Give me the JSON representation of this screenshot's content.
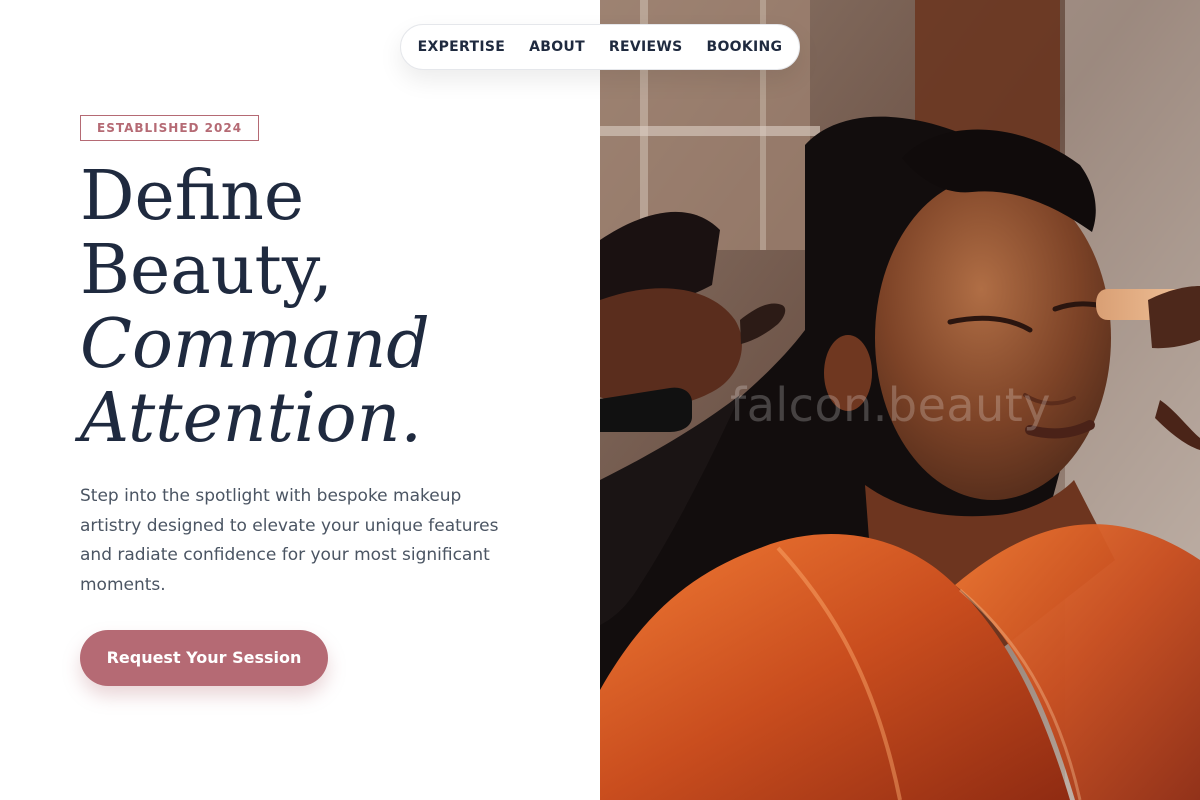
{
  "nav": {
    "items": [
      {
        "label": "EXPERTISE"
      },
      {
        "label": "ABOUT"
      },
      {
        "label": "REVIEWS"
      },
      {
        "label": "BOOKING"
      }
    ]
  },
  "hero": {
    "badge": "ESTABLISHED 2024",
    "headline_line1": "Define",
    "headline_line2": "Beauty,",
    "headline_line3": "Command",
    "headline_line4": "Attention.",
    "description": "Step into the spotlight with bespoke makeup artistry designed to elevate your unique features and radiate confidence for your most significant moments.",
    "cta_label": "Request Your Session"
  },
  "image": {
    "watermark": "falcon.beauty"
  },
  "colors": {
    "accent": "#b56a74",
    "heading": "#1f2a3f",
    "body_text": "#4b5563"
  }
}
